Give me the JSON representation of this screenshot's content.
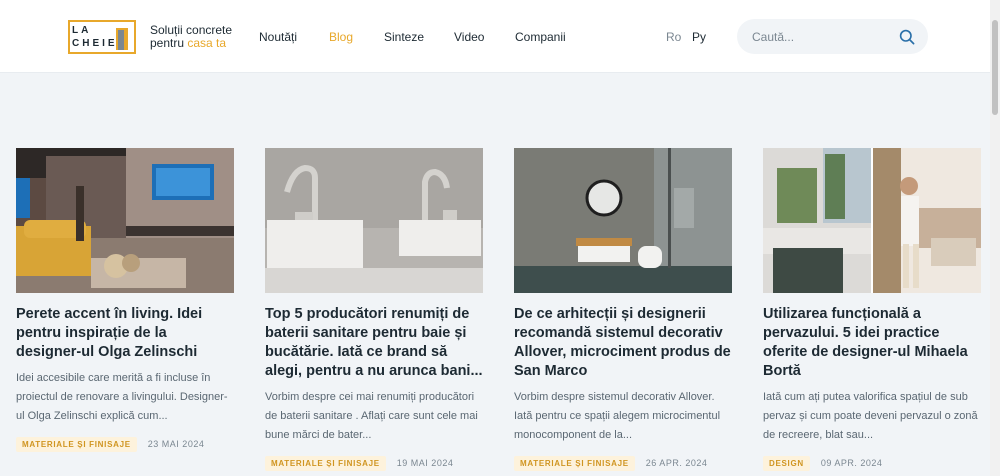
{
  "header": {
    "logo_line1": "LA",
    "logo_line2": "CHEIE",
    "tagline_line1": "Soluții concrete",
    "tagline_prefix": "pentru ",
    "tagline_accent": "casa ta",
    "nav": [
      "Noutăți",
      "Blog",
      "Sinteze",
      "Video",
      "Companii"
    ],
    "active_nav": "Blog",
    "languages": [
      "Ro",
      "Ру"
    ],
    "search_placeholder": "Caută..."
  },
  "colors": {
    "accent": "#e8a82b",
    "text": "#1d2a33",
    "muted": "#7b8791",
    "background": "#f1f4f7"
  },
  "articles": [
    {
      "title": "Perete accent în living. Idei pentru inspirație de la designer-ul Olga Zelinschi",
      "excerpt": "Idei accesibile care merită a fi incluse în proiectul de renovare a livingului. Designer-ul Olga Zelinschi explică cum...",
      "tag": "MATERIALE ȘI FINISAJE",
      "date": "23 MAI 2024",
      "image": "living-room-photo"
    },
    {
      "title": "Top 5 producători renumiți de baterii sanitare pentru baie și bucătărie. Iată ce brand să alegi, pentru a nu arunca bani...",
      "excerpt": "Vorbim despre cei mai renumiți producători de baterii sanitare . Aflați care sunt cele mai bune mărci de bater...",
      "tag": "MATERIALE ȘI FINISAJE",
      "date": "19 MAI 2024",
      "image": "faucets-photo"
    },
    {
      "title": "De ce arhitecții și designerii recomandă sistemul decorativ Allover,  microciment produs de San Marco",
      "excerpt": "Vorbim despre sistemul decorativ Allover. Iată pentru ce spații alegem microcimentul monocomponent de la...",
      "tag": "MATERIALE ȘI FINISAJE",
      "date": "26 APR. 2024",
      "image": "bathroom-photo"
    },
    {
      "title": "Utilizarea funcțională a pervazului. 5 idei practice oferite de designer-ul Mihaela Bortă",
      "excerpt": "Iată cum ați putea valorifica spațiul de sub pervaz și cum poate deveni pervazul o zonă de recreere, blat sau...",
      "tag": "DESIGN",
      "date": "09 APR. 2024",
      "image": "windowsill-photo"
    }
  ]
}
